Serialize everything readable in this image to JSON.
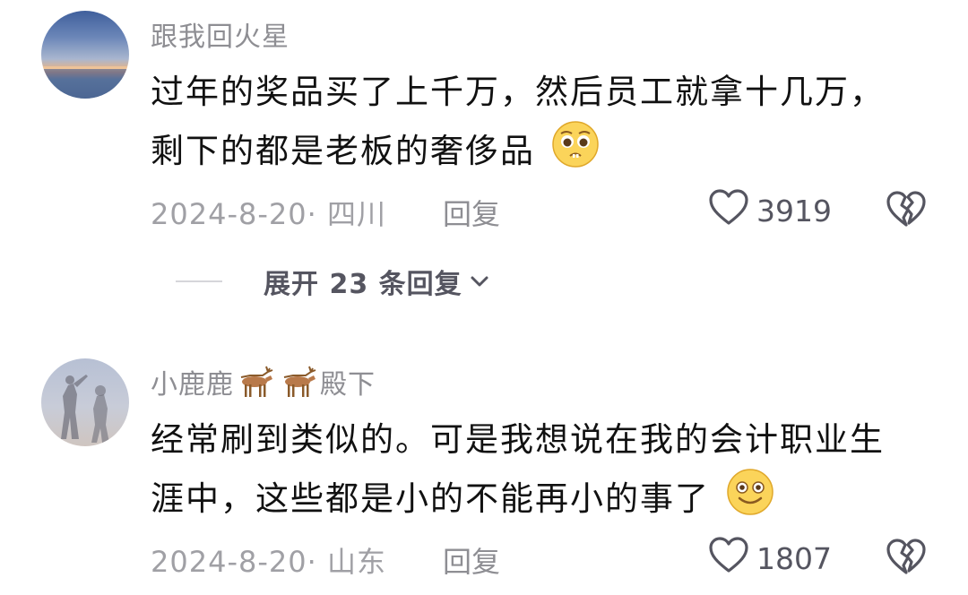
{
  "comments": [
    {
      "username": "跟我回火星",
      "text_line1": "过年的奖品买了上千万，然后员工就拿十几万，",
      "text_line2": "剩下的都是老板的奢侈品",
      "date_location": "2024-8-20· 四川",
      "reply_label": "回复",
      "likes": "3919",
      "expand_replies": "展开 23 条回复"
    },
    {
      "username_prefix": "小鹿鹿",
      "username_suffix": "殿下",
      "text_line1": "经常刷到类似的。可是我想说在我的会计职业生",
      "text_line2": "涯中，这些都是小的不能再小的事了",
      "date_location": "2024-8-20· 山东",
      "reply_label": "回复",
      "likes": "1807"
    }
  ]
}
